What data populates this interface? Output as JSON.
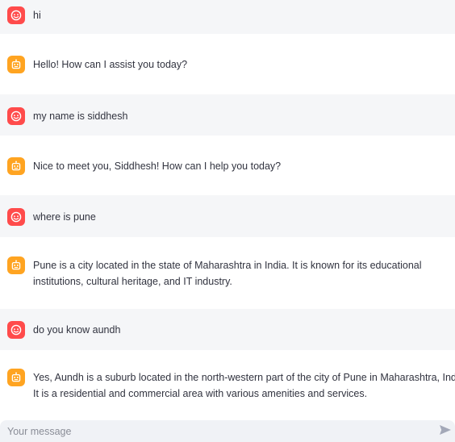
{
  "chat": {
    "messages": [
      {
        "role": "user",
        "lines": [
          "hi"
        ]
      },
      {
        "role": "assistant",
        "lines": [
          "Hello! How can I assist you today?"
        ]
      },
      {
        "role": "user",
        "lines": [
          "my name is siddhesh"
        ]
      },
      {
        "role": "assistant",
        "lines": [
          "Nice to meet you, Siddhesh! How can I help you today?"
        ]
      },
      {
        "role": "user",
        "lines": [
          "where is pune"
        ]
      },
      {
        "role": "assistant",
        "lines": [
          "Pune is a city located in the state of Maharashtra in India. It is known for its educational",
          "institutions, cultural heritage, and IT industry."
        ]
      },
      {
        "role": "user",
        "lines": [
          "do you know aundh"
        ]
      },
      {
        "role": "assistant",
        "lines": [
          "Yes, Aundh is a suburb located in the north-western part of the city of Pune in Maharashtra, India",
          "It is a residential and commercial area with various amenities and services."
        ]
      }
    ]
  },
  "input": {
    "placeholder": "Your message",
    "value": ""
  },
  "icons": {
    "user_avatar": "user-face-icon",
    "assistant_avatar": "robot-icon",
    "send": "send-arrow-icon"
  },
  "colors": {
    "user_avatar_bg": "#ff4b4b",
    "assistant_avatar_bg": "#ffa421",
    "user_row_bg": "#f5f6f8",
    "input_bg": "#f0f2f6",
    "send_icon": "#a3a8b8"
  }
}
